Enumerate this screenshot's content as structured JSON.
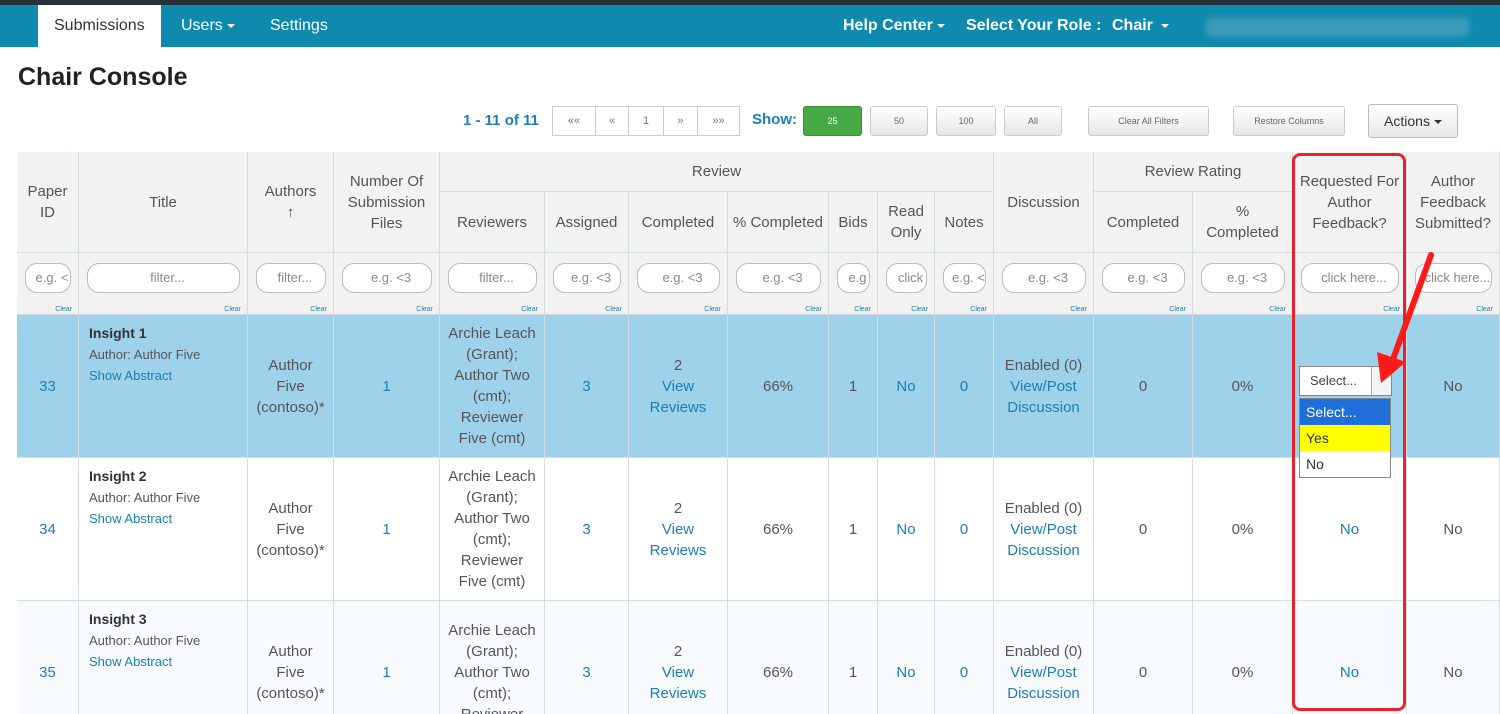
{
  "nav": {
    "tabs": [
      "Submissions",
      "Users",
      "Settings"
    ],
    "help": "Help Center",
    "role_label": "Select Your Role :",
    "role": "Chair"
  },
  "page_title": "Chair Console",
  "pager": {
    "info": "1 - 11 of 11",
    "buttons": [
      "««",
      "«",
      "1",
      "»",
      "»»"
    ],
    "show_label": "Show:",
    "sizes": [
      "25",
      "50",
      "100",
      "All"
    ],
    "clear_filters": "Clear All Filters",
    "restore_columns": "Restore Columns",
    "actions": "Actions"
  },
  "headers": {
    "paper_id": "Paper ID",
    "title": "Title",
    "authors": "Authors",
    "num_files": "Number Of Submission Files",
    "review": "Review",
    "reviewers": "Reviewers",
    "assigned": "Assigned",
    "completed": "Completed",
    "pct_completed": "% Completed",
    "bids": "Bids",
    "read_only": "Read Only",
    "notes": "Notes",
    "discussion": "Discussion",
    "review_rating": "Review Rating",
    "rr_completed": "Completed",
    "rr_pct": "% Completed",
    "requested": "Requested For Author Feedback?",
    "submitted": "Author Feedback Submitted?"
  },
  "filters": [
    "e.g. <",
    "filter...",
    "filter...",
    "e.g. <3",
    "filter...",
    "e.g. <3",
    "e.g. <3",
    "e.g. <3",
    "e.g",
    "click",
    "e.g. <",
    "e.g. <3",
    "e.g. <3",
    "e.g. <3",
    "click here...",
    "click here..."
  ],
  "clear": "Clear",
  "rows": [
    {
      "id": "33",
      "title": "Insight 1",
      "author_line": "Author: Author Five",
      "abstract": "Show Abstract",
      "authors": "Author Five (contoso)*",
      "files": "1",
      "reviewers": "Archie Leach (Grant); Author Two (cmt); Reviewer Five (cmt)",
      "assigned": "3",
      "completed": "2",
      "view_reviews": "View Reviews",
      "pct": "66%",
      "bids": "1",
      "read_only": "No",
      "notes": "0",
      "discussion": "Enabled (0)",
      "view_post": "View/Post Discussion",
      "rr_completed": "0",
      "rr_pct": "0%",
      "requested": "No",
      "submitted": "No"
    },
    {
      "id": "34",
      "title": "Insight 2",
      "author_line": "Author: Author Five",
      "abstract": "Show Abstract",
      "authors": "Author Five (contoso)*",
      "files": "1",
      "reviewers": "Archie Leach (Grant); Author Two (cmt); Reviewer Five (cmt)",
      "assigned": "3",
      "completed": "2",
      "view_reviews": "View Reviews",
      "pct": "66%",
      "bids": "1",
      "read_only": "No",
      "notes": "0",
      "discussion": "Enabled (0)",
      "view_post": "View/Post Discussion",
      "rr_completed": "0",
      "rr_pct": "0%",
      "requested": "No",
      "submitted": "No"
    },
    {
      "id": "35",
      "title": "Insight 3",
      "author_line": "Author: Author Five",
      "abstract": "Show Abstract",
      "authors": "Author Five (contoso)*",
      "files": "1",
      "reviewers": "Archie Leach (Grant); Author Two (cmt); Reviewer",
      "assigned": "3",
      "completed": "2",
      "view_reviews": "View Reviews",
      "pct": "66%",
      "bids": "1",
      "read_only": "No",
      "notes": "0",
      "discussion": "Enabled (0)",
      "view_post": "View/Post Discussion",
      "rr_completed": "0",
      "rr_pct": "0%",
      "requested": "No",
      "submitted": "No"
    }
  ],
  "dropdown": {
    "value": "Select...",
    "options": [
      "Select...",
      "Yes",
      "No"
    ]
  },
  "colors": {
    "topbar": "#0d8aad",
    "selected_row": "#9ed1ea",
    "highlight": "#e8232b"
  }
}
